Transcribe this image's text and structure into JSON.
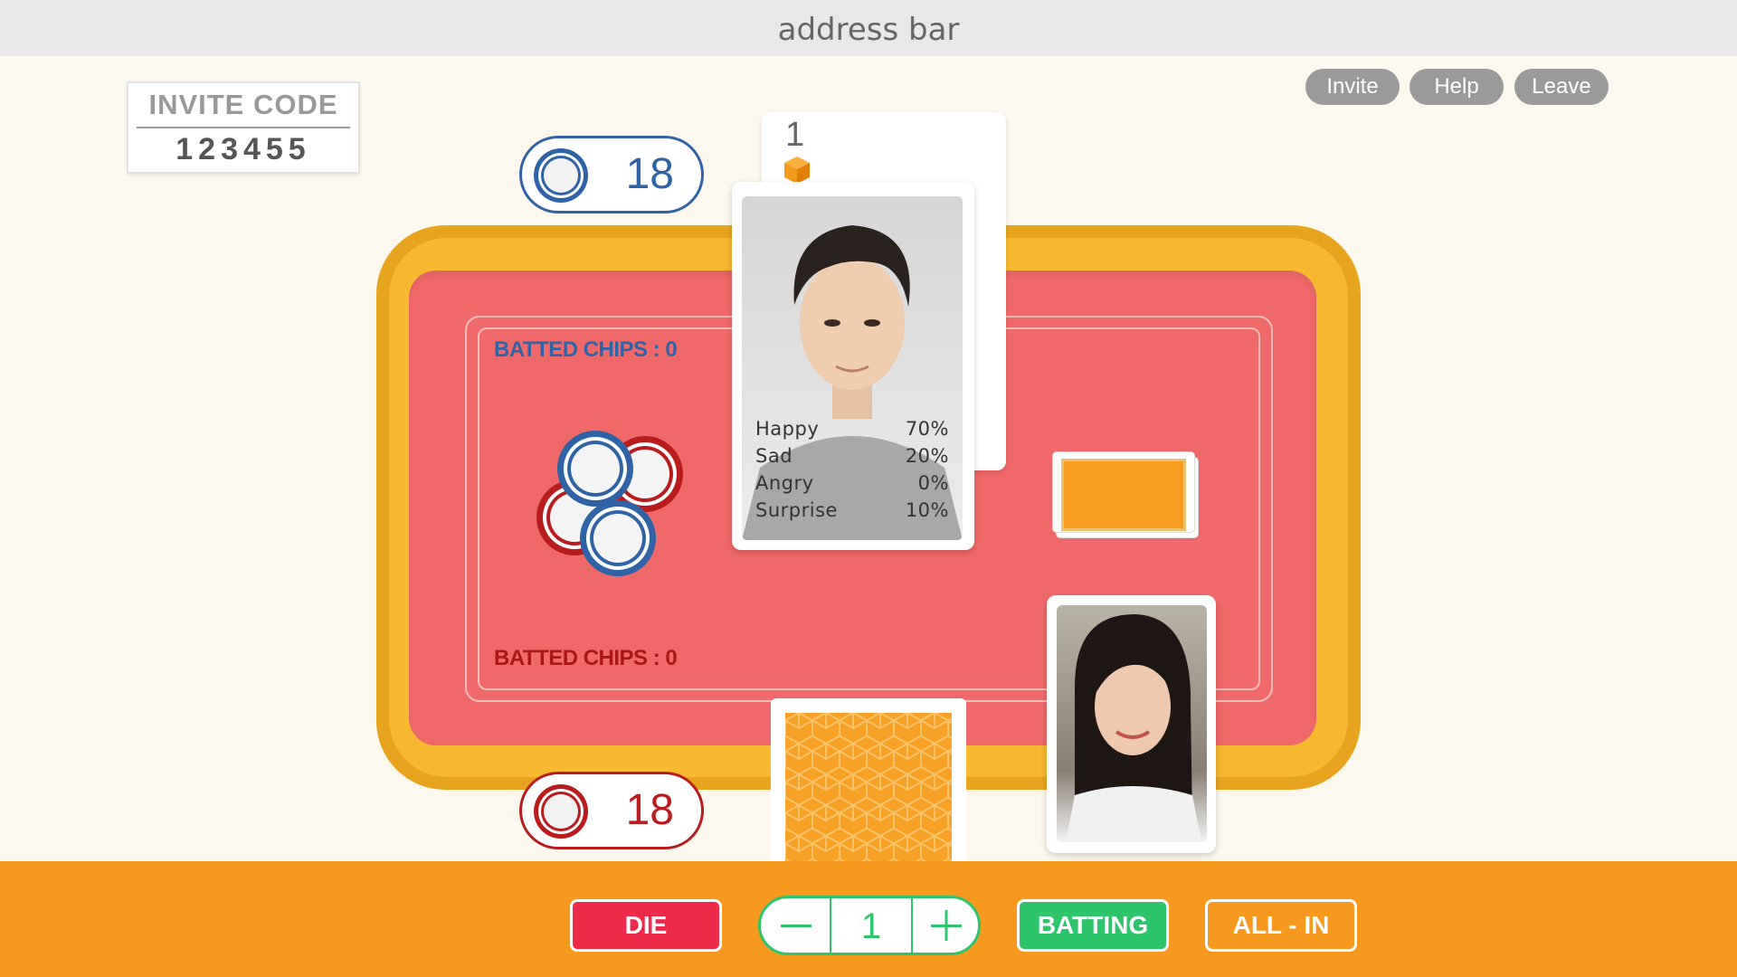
{
  "browser": {
    "address_bar": "address bar"
  },
  "invite": {
    "label": "INVITE CODE",
    "code": "123455"
  },
  "header_buttons": {
    "invite": "Invite",
    "help": "Help",
    "leave": "Leave"
  },
  "opponent": {
    "chips": "18",
    "card_number": "1",
    "batted_chips": "BATTED CHIPS : 0",
    "emotions": [
      {
        "label": "Happy",
        "value": "70%"
      },
      {
        "label": "Sad",
        "value": "20%"
      },
      {
        "label": "Angry",
        "value": "0%"
      },
      {
        "label": "Surprise",
        "value": "10%"
      }
    ]
  },
  "player": {
    "chips": "18",
    "batted_chips": "BATTED CHIPS : 0"
  },
  "controls": {
    "die": "DIE",
    "bet_amount": "1",
    "batting": "BATTING",
    "all_in": "ALL - IN"
  },
  "icons": {
    "opponent_chip": "blue-chip-icon",
    "player_chip": "red-chip-icon",
    "card_die": "orange-cube-icon",
    "minus": "minus-icon",
    "plus": "plus-icon"
  },
  "colors": {
    "table_rim": "#f6b930",
    "felt": "#f0696a",
    "opponent": "#2f63a6",
    "player": "#b81c1c",
    "bottom_bar": "#f7981f",
    "die_button": "#ec2a4a",
    "batting_button": "#2ec46b"
  }
}
